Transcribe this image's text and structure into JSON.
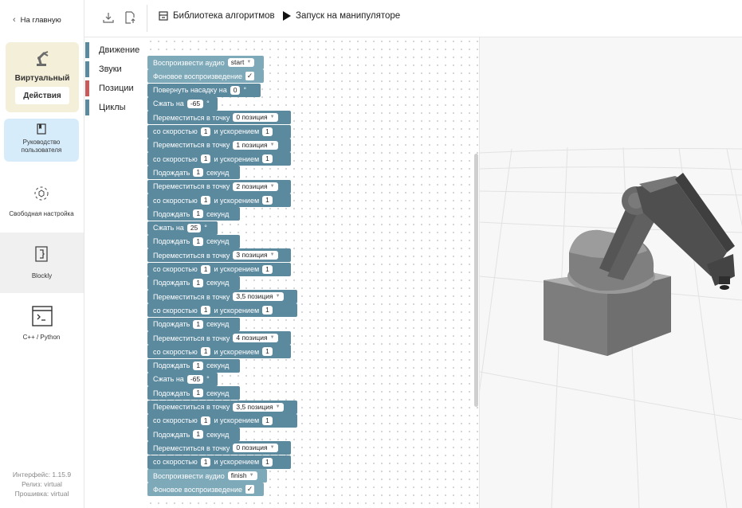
{
  "sidebar": {
    "back_label": "На главную",
    "mode": {
      "title": "Виртуальный",
      "actions_label": "Действия"
    },
    "guide_label": "Руководство пользователя",
    "free_label": "Свободная настройка",
    "blockly_label": "Blockly",
    "cpp_label": "C++ / Python",
    "versions": [
      "Интерфейс: 1.15.9",
      "Релиз: virtual",
      "Прошивка: virtual"
    ]
  },
  "toolbar": {
    "library_label": "Библиотека алгоритмов",
    "run_label": "Запуск на манипуляторе"
  },
  "categories": [
    {
      "label": "Движение",
      "color": "#5b8a9f"
    },
    {
      "label": "Звуки",
      "color": "#5b8a9f"
    },
    {
      "label": "Позиции",
      "color": "#c75b5b"
    },
    {
      "label": "Циклы",
      "color": "#5b8a9f"
    }
  ],
  "words": {
    "play_audio": "Воспроизвести аудио",
    "bg_play": "Фоновое воспроизведение",
    "rotate": "Повернуть насадку на",
    "degree": "°",
    "squeeze": "Сжать на",
    "move_to": "Переместиться в точку",
    "with_speed": "со скоростью",
    "and_accel": "и ускорением",
    "wait": "Подождать",
    "seconds": "секунд",
    "check": "✓",
    "dropdown_arrow": "▼"
  },
  "program": [
    {
      "kind": "audio",
      "value": "start"
    },
    {
      "kind": "bg"
    },
    {
      "kind": "rotate",
      "value": "0"
    },
    {
      "kind": "squeeze",
      "value": "-65"
    },
    {
      "kind": "move",
      "pos": "0 позиция",
      "speed": "1",
      "accel": "1"
    },
    {
      "kind": "move",
      "pos": "1 позиция",
      "speed": "1",
      "accel": "1"
    },
    {
      "kind": "wait",
      "value": "1"
    },
    {
      "kind": "move",
      "pos": "2 позиция",
      "speed": "1",
      "accel": "1"
    },
    {
      "kind": "wait",
      "value": "1"
    },
    {
      "kind": "squeeze",
      "value": "25"
    },
    {
      "kind": "wait",
      "value": "1"
    },
    {
      "kind": "move",
      "pos": "3 позиция",
      "speed": "1",
      "accel": "1"
    },
    {
      "kind": "wait",
      "value": "1"
    },
    {
      "kind": "move",
      "pos": "3,5 позиция",
      "speed": "1",
      "accel": "1"
    },
    {
      "kind": "wait",
      "value": "1"
    },
    {
      "kind": "move",
      "pos": "4 позиция",
      "speed": "1",
      "accel": "1"
    },
    {
      "kind": "wait",
      "value": "1"
    },
    {
      "kind": "squeeze",
      "value": "-65"
    },
    {
      "kind": "wait",
      "value": "1"
    },
    {
      "kind": "move",
      "pos": "3,5 позиция",
      "speed": "1",
      "accel": "1"
    },
    {
      "kind": "wait",
      "value": "1"
    },
    {
      "kind": "move",
      "pos": "0 позиция",
      "speed": "1",
      "accel": "1"
    },
    {
      "kind": "audio",
      "value": "finish"
    },
    {
      "kind": "bg"
    }
  ]
}
